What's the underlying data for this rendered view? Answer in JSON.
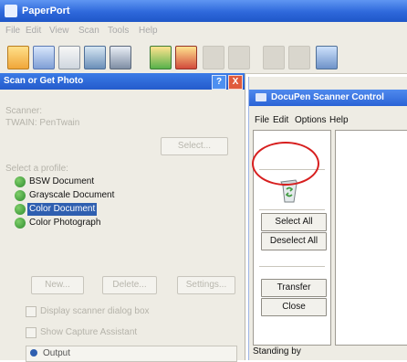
{
  "app": {
    "title": "PaperPort"
  },
  "menu": {
    "items": [
      "File",
      "Edit",
      "View",
      "Scan",
      "Tools",
      "Help"
    ]
  },
  "toolbar": {
    "icons": [
      "new-document-icon",
      "scan-icon",
      "page-icon",
      "view-icon",
      "profile-icon",
      "folder-icon",
      "share-icon",
      "disabled-icon-1",
      "disabled-icon-2",
      "disabled-icon-3",
      "disabled-icon-4",
      "disabled-icon-5"
    ]
  },
  "scan_panel": {
    "title": "Scan or Get Photo",
    "help": "?",
    "close": "X",
    "scanner_label": "Scanner:",
    "scanner_value": "TWAIN: PenTwain",
    "select_button": "Select...",
    "profile_label": "Select a profile:",
    "profiles": [
      {
        "label": "BSW Document",
        "selected": false
      },
      {
        "label": "Grayscale Document",
        "selected": false
      },
      {
        "label": "Color Document",
        "selected": true
      },
      {
        "label": "Color Photograph",
        "selected": false
      }
    ],
    "buttons": {
      "new": "New...",
      "delete": "Delete...",
      "settings": "Settings..."
    },
    "display_scanner_dialog": "Display scanner dialog box",
    "show_capture_assistant": "Show Capture Assistant",
    "output": "Output"
  },
  "docupen": {
    "title": "DocuPen Scanner Control",
    "menu": [
      "File",
      "Edit",
      "Options",
      "Help"
    ],
    "buttons": {
      "select_all": "Select All",
      "deselect_all": "Deselect All",
      "transfer": "Transfer",
      "close": "Close"
    },
    "status": "Standing by"
  }
}
